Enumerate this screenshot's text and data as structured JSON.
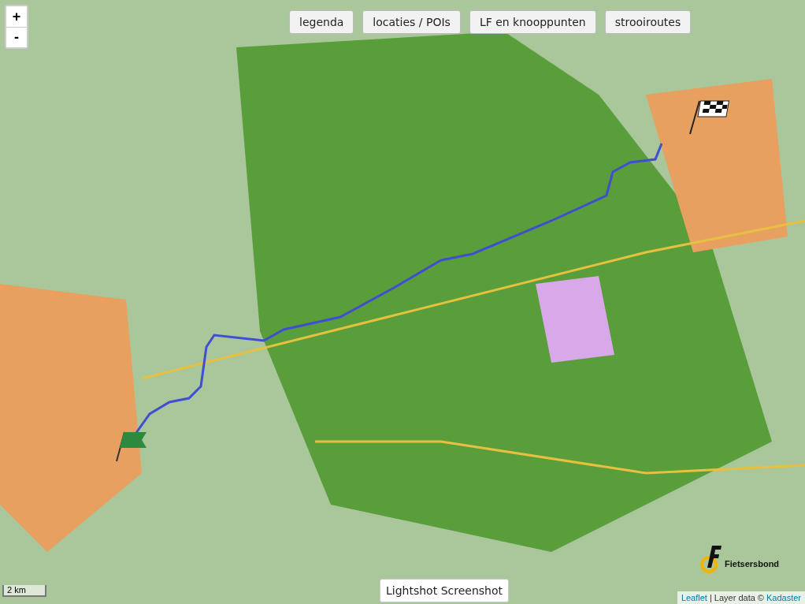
{
  "zoom_controls": [
    {
      "label": "+"
    },
    {
      "label": "-"
    }
  ],
  "layer_buttons": [
    {
      "label": "legenda"
    },
    {
      "label": "locaties / POIs"
    },
    {
      "label": "LF en knooppunten"
    },
    {
      "label": "strooiroutes"
    }
  ],
  "scale": {
    "label": "2 km"
  },
  "logo": {
    "text": "Fietsersbond"
  },
  "tooltip": {
    "text": "Lightshot Screenshot"
  },
  "attribution": [
    {
      "kind": "link",
      "text": "Leaflet"
    },
    {
      "kind": "text",
      "text": "| Layer data ©"
    },
    {
      "kind": "link",
      "text": "Kadaster"
    }
  ]
}
